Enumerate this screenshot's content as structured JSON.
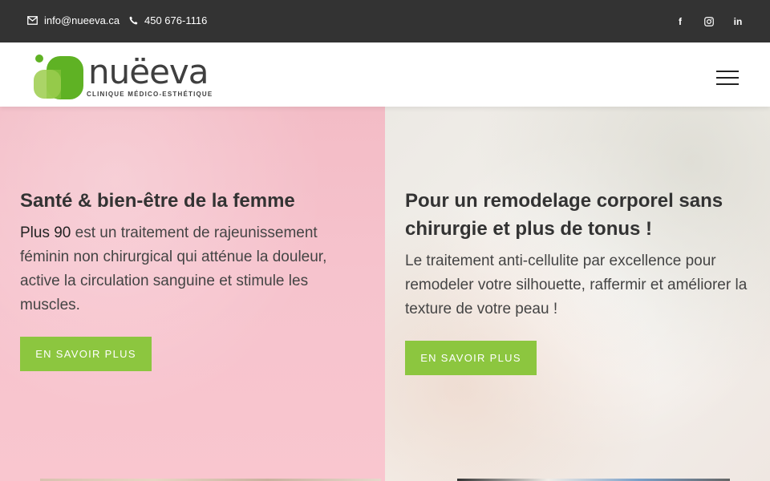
{
  "topbar": {
    "email": "info@nueeva.ca",
    "phone": "450 676-1116",
    "social": [
      {
        "name": "facebook",
        "glyph": "f"
      },
      {
        "name": "instagram",
        "glyph": ""
      },
      {
        "name": "linkedin",
        "glyph": "in"
      }
    ]
  },
  "header": {
    "logo_text": "nuëeva",
    "logo_tagline": "CLINIQUE MÉDICO-ESTHÉTIQUE"
  },
  "panels": [
    {
      "title": "Santé & bien-être de la femme",
      "text_bold": "Plus 90",
      "text": " est un traitement de rajeunissement féminin non chirurgical qui atténue la douleur, active la circulation sanguine et stimule les muscles.",
      "button": "EN SAVOIR PLUS"
    },
    {
      "title": "Pour un remodelage corporel sans chirurgie et plus de tonus !",
      "text": "Le traitement anti-cellulite par excellence pour remodeler votre silhouette, raffermir et améliorer la texture de votre peau !",
      "button": "EN SAVOIR PLUS"
    }
  ],
  "colors": {
    "topbar": "#333333",
    "accent_green": "#8cc63f",
    "logo_green_dark": "#5fb224",
    "logo_green_light": "#a6d25f",
    "pink_panel": "#f6c3cd"
  }
}
